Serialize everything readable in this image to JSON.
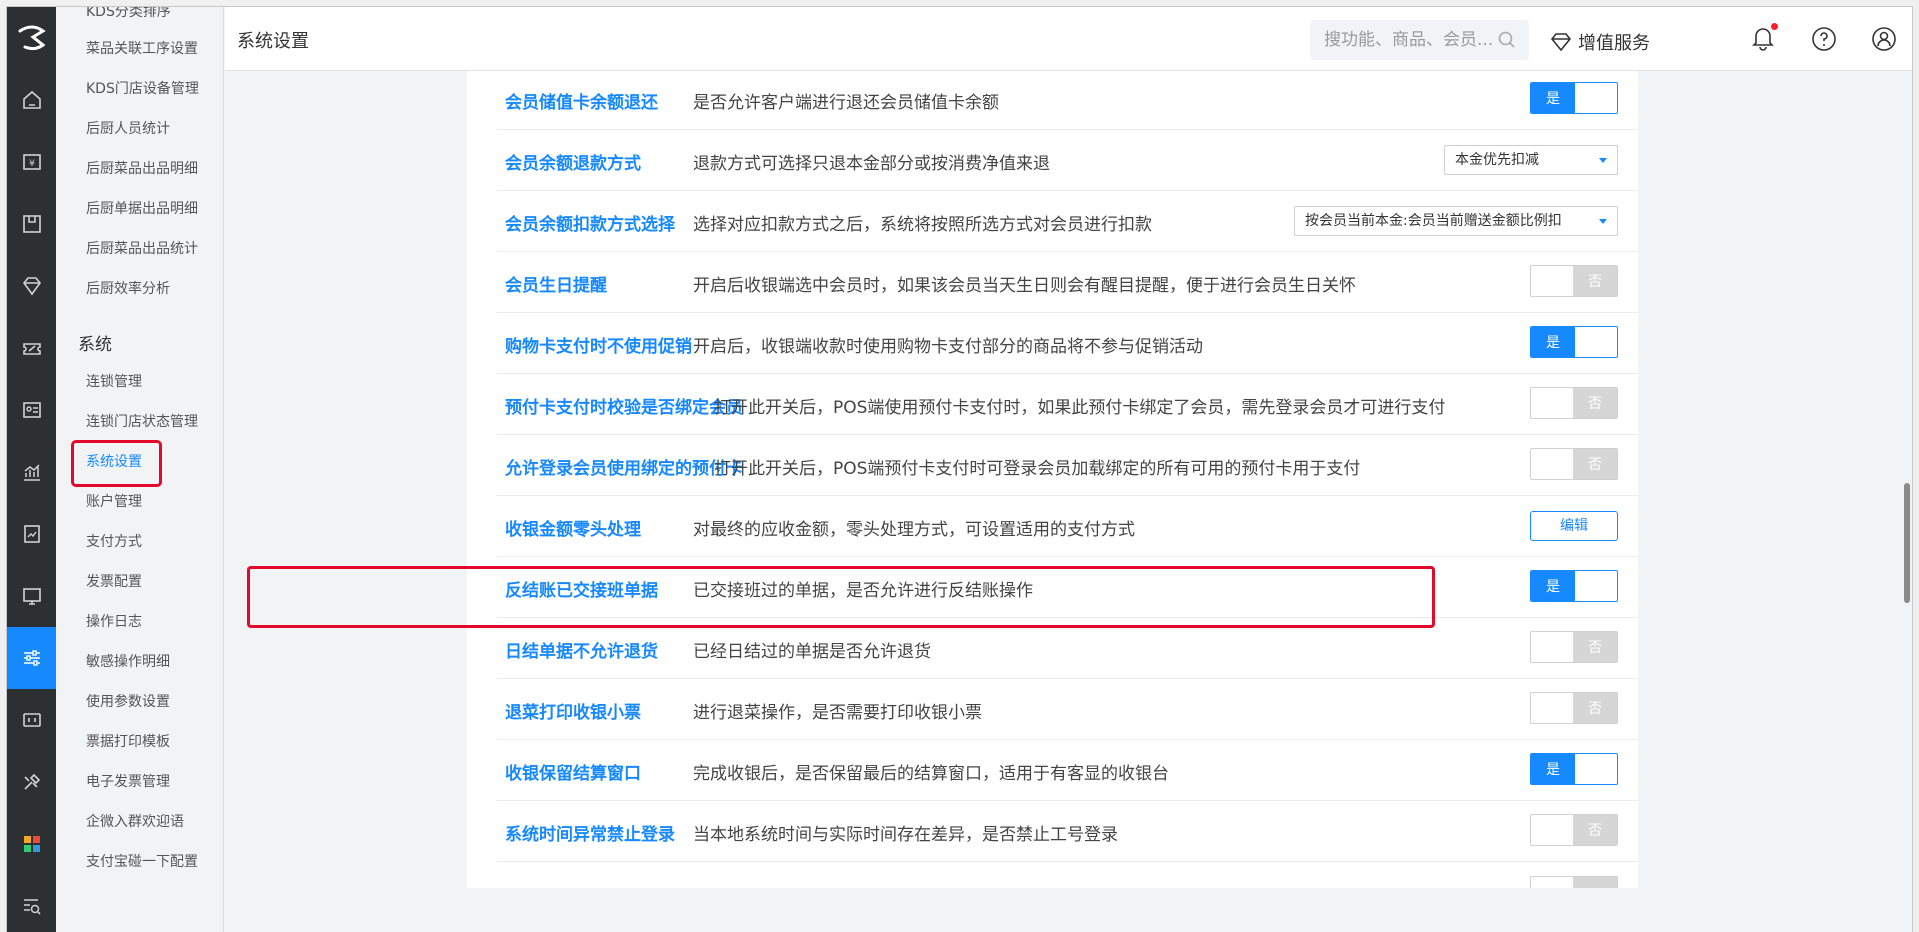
{
  "header": {
    "title": "系统设置",
    "search_placeholder": "搜功能、商品、会员...",
    "value_added_label": "增值服务"
  },
  "sidebar": {
    "top_items": [
      "KDS分类排序",
      "菜品关联工序设置",
      "KDS门店设备管理",
      "后厨人员统计",
      "后厨菜品出品明细",
      "后厨单据出品明细",
      "后厨菜品出品统计",
      "后厨效率分析"
    ],
    "group_title": "系统",
    "system_items": [
      "连锁管理",
      "连锁门店状态管理",
      "系统设置",
      "账户管理",
      "支付方式",
      "发票配置",
      "操作日志",
      "敏感操作明细",
      "使用参数设置",
      "票据打印模板",
      "电子发票管理",
      "企微入群欢迎语",
      "支付宝碰一下配置"
    ],
    "selected": "系统设置"
  },
  "settings": [
    {
      "name": "会员储值卡余额退还",
      "desc": "是否允许客户端进行退还会员储值卡余额",
      "control": "toggle",
      "value": "是"
    },
    {
      "name": "会员余额退款方式",
      "desc": "退款方式可选择只退本金部分或按消费净值来退",
      "control": "select",
      "value": "本金优先扣减"
    },
    {
      "name": "会员余额扣款方式选择",
      "desc": "选择对应扣款方式之后，系统将按照所选方式对会员进行扣款",
      "control": "select",
      "value": "按会员当前本金:会员当前赠送金额比例扣"
    },
    {
      "name": "会员生日提醒",
      "desc": "开启后收银端选中会员时，如果该会员当天生日则会有醒目提醒，便于进行会员生日关怀",
      "control": "toggle",
      "value": "否"
    },
    {
      "name": "购物卡支付时不使用促销",
      "desc": "开启后，收银端收款时使用购物卡支付部分的商品将不参与促销活动",
      "control": "toggle",
      "value": "是"
    },
    {
      "name": "预付卡支付时校验是否绑定会员",
      "desc": "打开此开关后，POS端使用预付卡支付时，如果此预付卡绑定了会员，需先登录会员才可进行支付",
      "control": "toggle",
      "value": "否"
    },
    {
      "name": "允许登录会员使用绑定的预付卡",
      "desc": "打开此开关后，POS端预付卡支付时可登录会员加载绑定的所有可用的预付卡用于支付",
      "control": "toggle",
      "value": "否"
    },
    {
      "name": "收银金额零头处理",
      "desc": "对最终的应收金额，零头处理方式，可设置适用的支付方式",
      "control": "button",
      "value": "编辑"
    },
    {
      "name": "反结账已交接班单据",
      "desc": "已交接班过的单据，是否允许进行反结账操作",
      "control": "toggle",
      "value": "是"
    },
    {
      "name": "日结单据不允许退货",
      "desc": "已经日结过的单据是否允许退货",
      "control": "toggle",
      "value": "否"
    },
    {
      "name": "退菜打印收银小票",
      "desc": "进行退菜操作，是否需要打印收银小票",
      "control": "toggle",
      "value": "否"
    },
    {
      "name": "收银保留结算窗口",
      "desc": "完成收银后，是否保留最后的结算窗口，适用于有客显的收银台",
      "control": "toggle",
      "value": "是"
    },
    {
      "name": "系统时间异常禁止登录",
      "desc": "当本地系统时间与实际时间存在差异，是否禁止工号登录",
      "control": "toggle",
      "value": "否"
    }
  ],
  "colors": {
    "accent": "#1789ff",
    "highlight": "#e4092a",
    "rail": "#2d3033"
  }
}
